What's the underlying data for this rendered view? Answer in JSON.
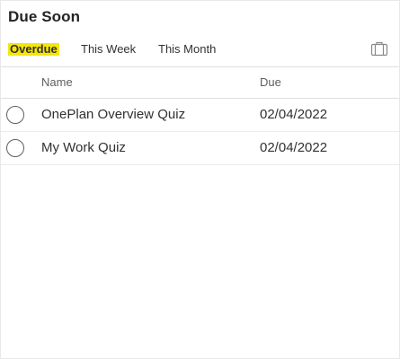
{
  "widget": {
    "title": "Due Soon"
  },
  "tabs": [
    {
      "label": "Overdue",
      "active": true
    },
    {
      "label": "This Week",
      "active": false
    },
    {
      "label": "This Month",
      "active": false
    }
  ],
  "toolbar": {
    "icon": "briefcase-icon"
  },
  "table": {
    "columns": [
      "Name",
      "Due"
    ],
    "rows": [
      {
        "name": "OnePlan Overview Quiz",
        "due": "02/04/2022",
        "checked": false
      },
      {
        "name": "My Work Quiz",
        "due": "02/04/2022",
        "checked": false
      }
    ]
  },
  "colors": {
    "highlight": "#f5e60a",
    "text": "#323130",
    "muted": "#605e5c",
    "border": "#e1dfdd"
  }
}
